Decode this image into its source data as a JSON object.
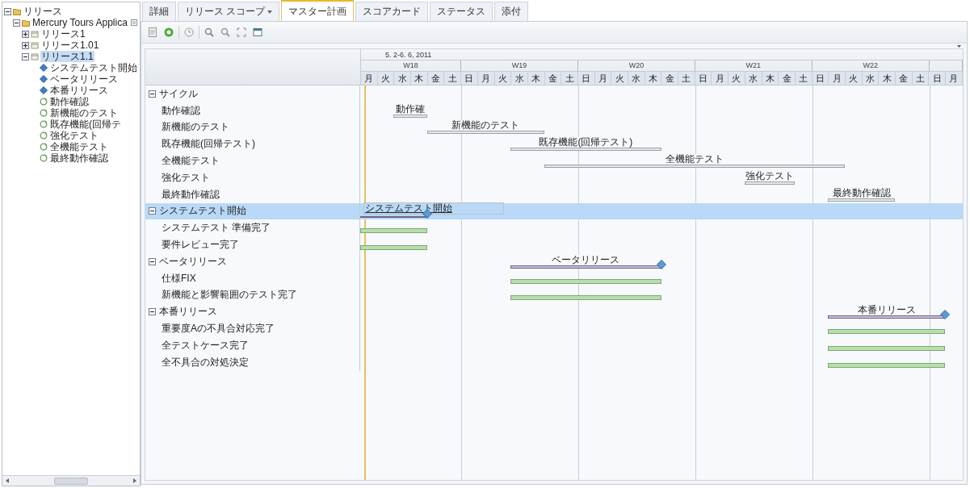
{
  "tree": {
    "items": [
      {
        "label": "リリース",
        "kind": "folder",
        "expanded": true,
        "selected": false,
        "children": [
          {
            "label": "Mercury Tours Applica",
            "kind": "folder",
            "expanded": true,
            "selected": false,
            "children": [
              {
                "label": "リリース1",
                "kind": "release",
                "expanded": false,
                "selected": false
              },
              {
                "label": "リリース1.01",
                "kind": "release",
                "expanded": false,
                "selected": false
              },
              {
                "label": "リリース1.1",
                "kind": "release",
                "expanded": true,
                "selected": true,
                "children": [
                  {
                    "label": "システムテスト開始",
                    "kind": "milestone",
                    "selected": false
                  },
                  {
                    "label": "ベータリリース",
                    "kind": "milestone",
                    "selected": false
                  },
                  {
                    "label": "本番リリース",
                    "kind": "milestone",
                    "selected": false
                  },
                  {
                    "label": "動作確認",
                    "kind": "cycle",
                    "selected": false
                  },
                  {
                    "label": "新機能のテスト",
                    "kind": "cycle",
                    "selected": false
                  },
                  {
                    "label": "既存機能(回帰テ",
                    "kind": "cycle",
                    "selected": false
                  },
                  {
                    "label": "強化テスト",
                    "kind": "cycle",
                    "selected": false
                  },
                  {
                    "label": "全機能テスト",
                    "kind": "cycle",
                    "selected": false
                  },
                  {
                    "label": "最終動作確認",
                    "kind": "cycle",
                    "selected": false
                  }
                ]
              }
            ]
          }
        ]
      }
    ]
  },
  "tabs": [
    {
      "label": "詳細",
      "selected": false,
      "has_menu": false
    },
    {
      "label": "リリース スコープ",
      "selected": false,
      "has_menu": true
    },
    {
      "label": "マスター計画",
      "selected": true,
      "has_menu": false
    },
    {
      "label": "スコアカード",
      "selected": false,
      "has_menu": false
    },
    {
      "label": "ステータス",
      "selected": false,
      "has_menu": false
    },
    {
      "label": "添付",
      "selected": false,
      "has_menu": false
    }
  ],
  "timeline": {
    "range": "5. 2-6. 6, 2011",
    "weeks": [
      {
        "label": "W18",
        "days": [
          "月",
          "火",
          "水",
          "木",
          "金",
          "土"
        ]
      },
      {
        "label": "W19",
        "days": [
          "日",
          "月",
          "火",
          "水",
          "木",
          "金",
          "土"
        ]
      },
      {
        "label": "W20",
        "days": [
          "日",
          "月",
          "火",
          "水",
          "木",
          "金",
          "土"
        ]
      },
      {
        "label": "W21",
        "days": [
          "日",
          "月",
          "火",
          "水",
          "木",
          "金",
          "土"
        ]
      },
      {
        "label": "W22",
        "days": [
          "日",
          "月",
          "火",
          "水",
          "木",
          "金",
          "土"
        ]
      },
      {
        "days": [
          "日",
          "月"
        ]
      }
    ]
  },
  "groups": [
    {
      "label": "サイクル",
      "expanded": true,
      "selected": false,
      "children": [
        {
          "label": "動作確認",
          "bar": {
            "kind": "cycle",
            "label": "動作確"
          }
        },
        {
          "label": "新機能のテスト",
          "bar": {
            "kind": "cycle",
            "label": "新機能のテスト"
          }
        },
        {
          "label": "既存機能(回帰テスト)",
          "bar": {
            "kind": "cycle",
            "label": "既存機能(回帰テスト)"
          }
        },
        {
          "label": "全機能テスト",
          "bar": {
            "kind": "cycle",
            "label": "全機能テスト"
          }
        },
        {
          "label": "強化テスト",
          "bar": {
            "kind": "cycle",
            "label": "強化テスト"
          }
        },
        {
          "label": "最終動作確認",
          "bar": {
            "kind": "cycle",
            "label": "最終動作確認"
          }
        }
      ]
    },
    {
      "label": "システムテスト開始",
      "expanded": true,
      "selected": true,
      "bar": {
        "kind": "milestone",
        "label": "システムテスト開始"
      },
      "children": [
        {
          "label": "システムテスト 準備完了",
          "bar": {
            "kind": "requirement"
          }
        },
        {
          "label": "要件レビュー完了",
          "bar": {
            "kind": "requirement"
          }
        }
      ]
    },
    {
      "label": "ベータリリース",
      "expanded": true,
      "selected": false,
      "bar": {
        "kind": "milestone",
        "label": "ベータリリース"
      },
      "children": [
        {
          "label": "仕様FIX",
          "bar": {
            "kind": "requirement"
          }
        },
        {
          "label": "新機能と影響範囲のテスト完了",
          "bar": {
            "kind": "requirement"
          }
        }
      ]
    },
    {
      "label": "本番リリース",
      "expanded": true,
      "selected": false,
      "bar": {
        "kind": "milestone",
        "label": "本番リリース"
      },
      "children": [
        {
          "label": "重要度Aの不具合対応完了",
          "bar": {
            "kind": "requirement"
          }
        },
        {
          "label": "全テストケース完了",
          "bar": {
            "kind": "requirement"
          }
        },
        {
          "label": "全不具合の対処決定",
          "bar": {
            "kind": "requirement"
          }
        }
      ]
    }
  ]
}
